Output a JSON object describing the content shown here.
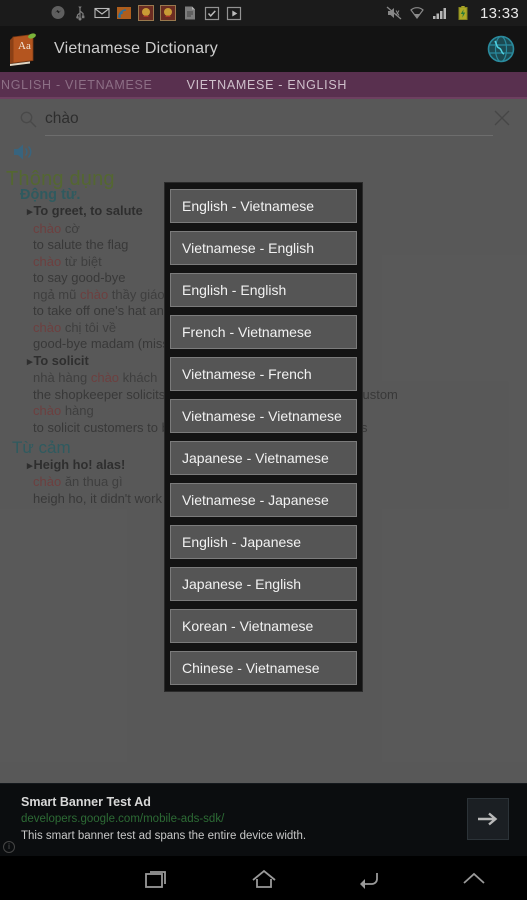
{
  "status_bar": {
    "time": "13:33",
    "left_icons": [
      "messenger-icon",
      "usb-icon",
      "gmail-icon",
      "feed-icon",
      "game1-icon",
      "game2-icon",
      "file-icon",
      "checkbox-app-icon",
      "play-store-icon"
    ],
    "right_icons": [
      "mute-icon",
      "wifi-icon",
      "signal-icon",
      "battery-charging-icon"
    ]
  },
  "action_bar": {
    "app_icon": "dictionary-book-icon",
    "title": "Vietnamese Dictionary",
    "globe_icon": "globe-icon"
  },
  "tabs": [
    {
      "label": "ENGLISH - VIETNAMESE",
      "active": false
    },
    {
      "label": "VIETNAMESE - ENGLISH",
      "active": true
    }
  ],
  "search": {
    "value": "chào",
    "placeholder": "",
    "search_icon": "search-icon",
    "clear_icon": "close-icon",
    "speaker_icon": "speaker-icon"
  },
  "definition": {
    "section_title": "Thông dụng",
    "part_of_speech": "Động từ.",
    "senses": [
      {
        "headword": "To greet, to salute",
        "lines": [
          {
            "vi": "chào",
            "vi_rest": " cờ",
            "en": "to salute the flag"
          },
          {
            "vi": "chào",
            "vi_rest": " từ biệt",
            "en": "to say good-bye"
          },
          {
            "vi_pre": "ngả mũ ",
            "vi": "chào",
            "vi_rest": " thầy giáo",
            "en": "to take off one's hat and greet the teacher"
          },
          {
            "vi": "chào",
            "vi_rest": " chị tôi về",
            "en": "good-bye madam (miss, mrs)"
          }
        ]
      },
      {
        "headword": "To solicit",
        "lines": [
          {
            "vi_pre": "nhà hàng ",
            "vi": "chào",
            "vi_rest": " khách",
            "en": "the shopkeeper solicits customers, calls people for their custom"
          },
          {
            "vi": "chào",
            "vi_rest": " hàng",
            "en": "to solicit customers to buy one's goods, to cry one's wares"
          }
        ]
      }
    ],
    "section_title2": "Từ cảm",
    "senses2": [
      {
        "headword": "Heigh ho! alas!",
        "lines": [
          {
            "vi": "chào",
            "vi_rest": " ăn thua gì",
            "en": "heigh ho, it didn't work"
          }
        ]
      }
    ]
  },
  "dialog": {
    "items": [
      "English - Vietnamese",
      "Vietnamese - English",
      "English - English",
      "French - Vietnamese",
      "Vietnamese - French",
      "Vietnamese - Vietnamese",
      "Japanese - Vietnamese",
      "Vietnamese - Japanese",
      "English - Japanese",
      "Japanese - English",
      "Korean  - Vietnamese",
      "Chinese - Vietnamese"
    ]
  },
  "ad": {
    "title": "Smart Banner Test Ad",
    "url": "developers.google.com/mobile-ads-sdk/",
    "description": "This smart banner test ad spans the entire device width.",
    "arrow_icon": "arrow-right-icon",
    "info_label": "i"
  },
  "nav_bar": {
    "buttons": [
      "recents-icon",
      "home-icon",
      "back-icon",
      "chevron-up-icon"
    ]
  },
  "colors": {
    "tab_bar": "#59304f",
    "section_green": "#5f8023",
    "pos_teal": "#1f6a72",
    "vi_red": "#8a3b3b",
    "ad_url_green": "#2d6b35"
  }
}
